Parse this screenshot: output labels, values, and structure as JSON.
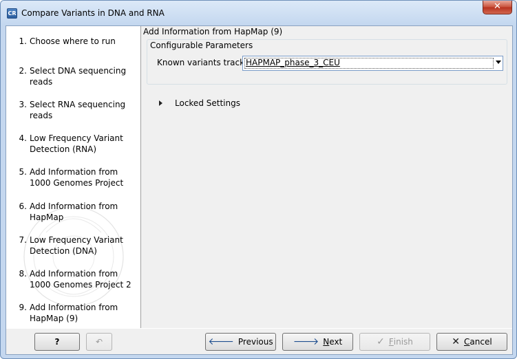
{
  "window": {
    "icon_text": "CR",
    "title": "Compare Variants in DNA and RNA",
    "close_glyph": "✕"
  },
  "steps": [
    {
      "num": "1.",
      "label": "Choose where to run"
    },
    {
      "num": "2.",
      "label": "Select DNA sequencing reads"
    },
    {
      "num": "3.",
      "label": "Select RNA sequencing reads"
    },
    {
      "num": "4.",
      "label": "Low Frequency Variant Detection (RNA)"
    },
    {
      "num": "5.",
      "label": "Add Information from 1000 Genomes Project"
    },
    {
      "num": "6.",
      "label": "Add Information from HapMap"
    },
    {
      "num": "7.",
      "label": "Low Frequency Variant Detection (DNA)"
    },
    {
      "num": "8.",
      "label": "Add Information from 1000 Genomes Project 2"
    },
    {
      "num": "9.",
      "label": "Add Information from HapMap (9)"
    }
  ],
  "main": {
    "section_title": "Add Information from HapMap (9)",
    "group_legend": "Configurable Parameters",
    "field_label": "Known variants track",
    "field_value": "HAPMAP_phase_3_CEU",
    "locked_label": "Locked Settings"
  },
  "footer": {
    "help_label": "?",
    "previous_label": "Previous",
    "next_mnemonic": "N",
    "next_rest": "ext",
    "finish_mnemonic": "F",
    "finish_rest": "inish",
    "cancel_mnemonic": "C",
    "cancel_rest": "ancel"
  },
  "icons": {
    "previous": "🡐",
    "next": "🡒",
    "finish": "✓",
    "cancel": "✕",
    "back": "↶"
  }
}
